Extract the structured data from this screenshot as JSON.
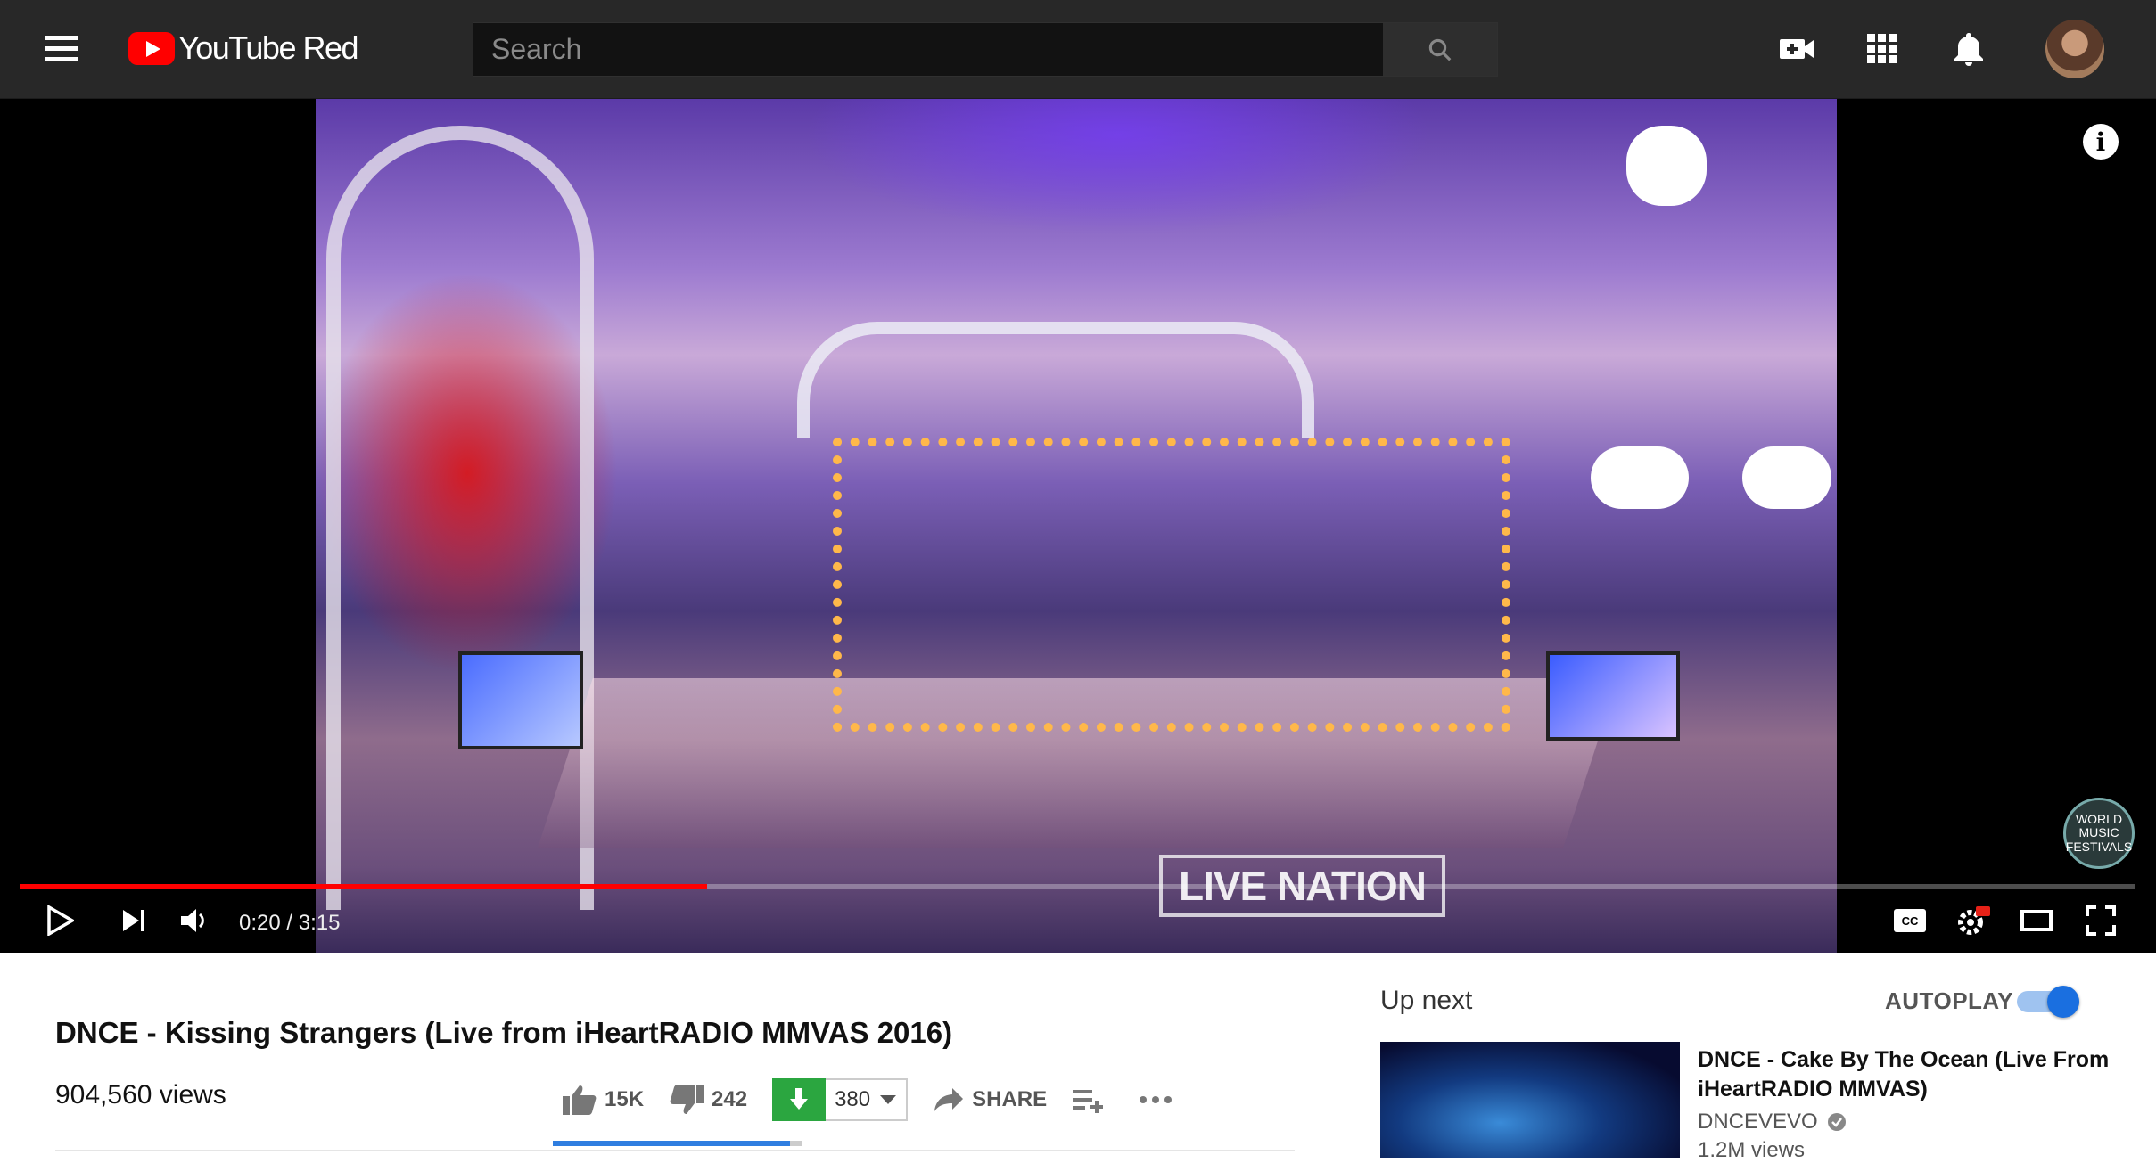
{
  "masthead": {
    "brand": "YouTube Red",
    "search": {
      "placeholder": "Search",
      "value": ""
    }
  },
  "player": {
    "progress_percent": 32.5,
    "time_display": "0:20 / 3:15",
    "watermark": "LIVE NATION",
    "corner_badge": "WORLD MUSIC FESTIVALS",
    "colors": {
      "progress": "#ff0000",
      "background": "#000000"
    }
  },
  "video": {
    "title": "DNCE - Kissing Strangers (Live from iHeartRADIO MMVAS 2016)",
    "views": "904,560 views",
    "likes": "15K",
    "dislikes": "242",
    "download_count": "380",
    "share_label": "SHARE",
    "sentiment_like_fraction": 0.95
  },
  "secondary": {
    "up_next_label": "Up next",
    "autoplay_label": "AUTOPLAY",
    "autoplay_on": true,
    "next_video": {
      "title": "DNCE - Cake By The Ocean (Live From iHeartRADIO MMVAS)",
      "channel": "DNCEVEVO",
      "views": "1.2M views"
    }
  }
}
